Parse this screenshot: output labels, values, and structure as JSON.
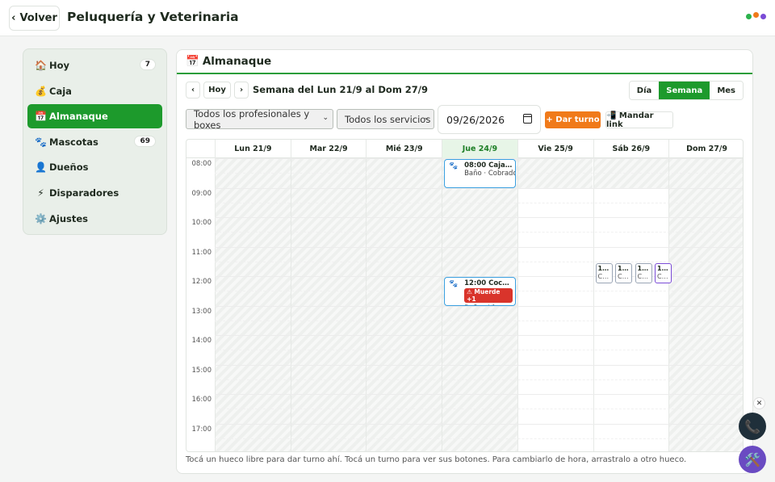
{
  "header": {
    "back_label": "Volver",
    "back_icon": "‹",
    "title": "Peluquería y Veterinaria",
    "status_colors": [
      "#2bb24c",
      "#f07a1a",
      "#7a4bd6"
    ]
  },
  "sidebar": {
    "items": [
      {
        "icon": "🏠",
        "label": "Hoy",
        "count": "7",
        "active": false
      },
      {
        "icon": "💰",
        "label": "Caja",
        "count": "",
        "active": false
      },
      {
        "icon": "📅",
        "label": "Almanaque",
        "count": "",
        "active": true
      },
      {
        "icon": "🐾",
        "label": "Mascotas",
        "count": "69",
        "active": false
      },
      {
        "icon": "👤",
        "label": "Dueños",
        "count": "",
        "active": false
      },
      {
        "icon": "⚡",
        "label": "Disparadores",
        "count": "",
        "active": false
      },
      {
        "icon": "⚙️",
        "label": "Ajustes",
        "count": "",
        "active": false
      }
    ]
  },
  "main": {
    "icon": "📅",
    "title": "Almanaque",
    "prev": "‹",
    "today": "Hoy",
    "next": "›",
    "week_label": "Semana del Lun 21/9 al Dom 27/9",
    "views": [
      "Día",
      "Semana",
      "Mes"
    ],
    "active_view": "Semana",
    "filter_professional": "Todos los profesionales y boxes",
    "filter_service": "Todos los servicios",
    "date_value": "09/26/2026",
    "add_button": "+ Dar turno",
    "link_button": "📲 Mandar link",
    "hint": "Tocá un hueco libre para dar turno ahí. Tocá un turno para ver sus botones. Para cambiarlo de hora, arrastralo a otro hueco."
  },
  "calendar": {
    "days": [
      "Lun 21/9",
      "Mar 22/9",
      "Mié 23/9",
      "Jue 24/9",
      "Vie 25/9",
      "Sáb 26/9",
      "Dom 27/9"
    ],
    "today_index": 3,
    "hours": [
      "08:00",
      "09:00",
      "10:00",
      "11:00",
      "12:00",
      "13:00",
      "14:00",
      "15:00",
      "16:00",
      "17:00"
    ],
    "appointments": [
      {
        "day": 3,
        "start": 8.0,
        "end": 9.0,
        "title": "08:00 Caja 0…",
        "sub": "Baño · Cobrado",
        "warn": ""
      },
      {
        "day": 3,
        "start": 12.0,
        "end": 13.0,
        "title": "12:00 Coco 0…",
        "sub": "Baño · Vino",
        "warn": "⚠ Muerde +1"
      }
    ],
    "mini_appts": [
      {
        "a": "1…",
        "b": "C…",
        "color": "#9aa5b5"
      },
      {
        "a": "1…",
        "b": "C…",
        "color": "#9aa5b5"
      },
      {
        "a": "1…",
        "b": "C…",
        "color": "#9aa5b5"
      },
      {
        "a": "1…",
        "b": "C…",
        "color": "#7a4bd6"
      }
    ]
  },
  "fabs": {
    "close": "✕",
    "phone": "📞",
    "tools": "🛠️"
  }
}
